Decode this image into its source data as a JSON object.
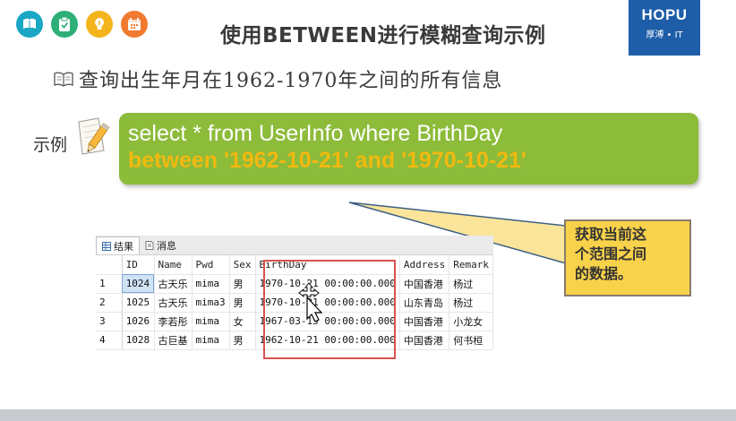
{
  "header": {
    "icons": [
      {
        "name": "book-icon",
        "color": "#1aa7c4"
      },
      {
        "name": "clipboard-check-icon",
        "color": "#2faf78"
      },
      {
        "name": "lightbulb-icon",
        "color": "#f3b41c"
      },
      {
        "name": "calendar-icon",
        "color": "#f07a2f"
      }
    ],
    "title": "使用BETWEEN进行模糊查询示例",
    "brand": {
      "name": "HOPU",
      "sub": "厚溥 • IT",
      "color": "#1e5da8"
    }
  },
  "subtitle": "查询出生年月在1962-1970年之间的所有信息",
  "example": {
    "label": "示例",
    "code_line1": "select * from UserInfo where BirthDay",
    "code_line2": "between '1962-10-21' and '1970-10-21'",
    "box_color": "#8dbb3a",
    "highlight_color": "#f2b90f"
  },
  "callout": {
    "text": [
      "获取当前这",
      "个范围之间",
      "的数据。"
    ],
    "color": "#f8d24a"
  },
  "results": {
    "tabs": [
      "结果",
      "消息"
    ],
    "columns": [
      "ID",
      "Name",
      "Pwd",
      "Sex",
      "BirthDay",
      "Address",
      "Remark"
    ],
    "rows": [
      {
        "n": "1",
        "id": "1024",
        "name": "古天乐",
        "pwd": "mima",
        "sex": "男",
        "birthday": "1970-10-21 00:00:00.000",
        "address": "中国香港",
        "remark": "杨过"
      },
      {
        "n": "2",
        "id": "1025",
        "name": "古天乐",
        "pwd": "mima3",
        "sex": "男",
        "birthday": "1970-10-21 00:00:00.000",
        "address": "山东青岛",
        "remark": "杨过"
      },
      {
        "n": "3",
        "id": "1026",
        "name": "李若彤",
        "pwd": "mima",
        "sex": "女",
        "birthday": "1967-03-15 00:00:00.000",
        "address": "中国香港",
        "remark": "小龙女"
      },
      {
        "n": "4",
        "id": "1028",
        "name": "古巨基",
        "pwd": "mima",
        "sex": "男",
        "birthday": "1962-10-21 00:00:00.000",
        "address": "中国香港",
        "remark": "何书桓"
      }
    ]
  }
}
